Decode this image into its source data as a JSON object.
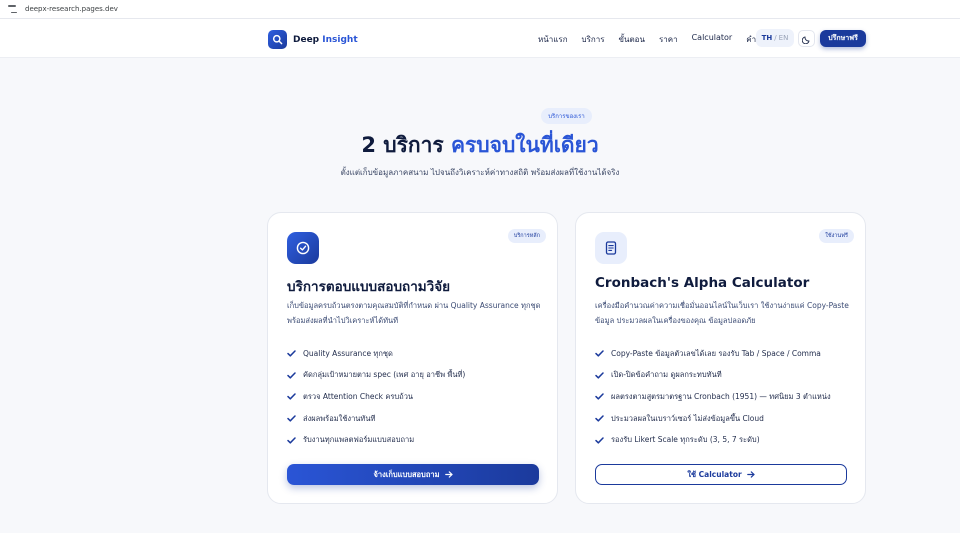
{
  "browser": {
    "url": "deepx-research.pages.dev"
  },
  "header": {
    "logo_text": "Deep",
    "logo_highlight": "Insight",
    "nav": [
      {
        "label": "หน้าแรก"
      },
      {
        "label": "บริการ"
      },
      {
        "label": "ขั้นตอน"
      },
      {
        "label": "ราคา"
      },
      {
        "label": "Calculator"
      },
      {
        "label": "คำถาม"
      }
    ],
    "lang_th": "TH",
    "lang_sep": "/",
    "lang_en": "EN",
    "cta_label": "ปรึกษาฟรี"
  },
  "hero": {
    "pill": "บริการของเรา",
    "title_plain": "2 บริการ",
    "title_highlight": "ครบจบในที่เดียว",
    "subtitle": "ตั้งแต่เก็บข้อมูลภาคสนาม ไปจนถึงวิเคราะห์ค่าทางสถิติ พร้อมส่งผลที่ใช้งานได้จริง"
  },
  "cards": [
    {
      "badge": "บริการหลัก",
      "title": "บริการตอบแบบสอบถามวิจัย",
      "description": "เก็บข้อมูลครบถ้วนตรงตามคุณสมบัติที่กำหนด ผ่าน Quality Assurance ทุกชุด พร้อมส่งผลที่นำไปวิเคราะห์ได้ทันที",
      "features": [
        "Quality Assurance ทุกชุด",
        "คัดกลุ่มเป้าหมายตาม spec (เพศ อายุ อาชีพ พื้นที่)",
        "ตรวจ Attention Check ครบถ้วน",
        "ส่งผลพร้อมใช้งานทันที",
        "รับงานทุกแพลตฟอร์มแบบสอบถาม"
      ],
      "button": "จ้างเก็บแบบสอบถาม"
    },
    {
      "badge": "ใช้งานฟรี",
      "title": "Cronbach's Alpha Calculator",
      "description": "เครื่องมือคำนวณค่าความเชื่อมั่นออนไลน์ในเว็บเรา ใช้งานง่ายแค่ Copy-Paste ข้อมูล ประมวลผลในเครื่องของคุณ ข้อมูลปลอดภัย",
      "features": [
        "Copy-Paste ข้อมูลตัวเลขได้เลย รองรับ Tab / Space / Comma",
        "เปิด-ปิดข้อคำถาม ดูผลกระทบทันที",
        "ผลตรงตามสูตรมาตรฐาน Cronbach (1951) — ทศนิยม 3 ตำแหน่ง",
        "ประมวลผลในเบราว์เซอร์ ไม่ส่งข้อมูลขึ้น Cloud",
        "รองรับ Likert Scale ทุกระดับ (3, 5, 7 ระดับ)"
      ],
      "button": "ใช้ Calculator"
    }
  ]
}
